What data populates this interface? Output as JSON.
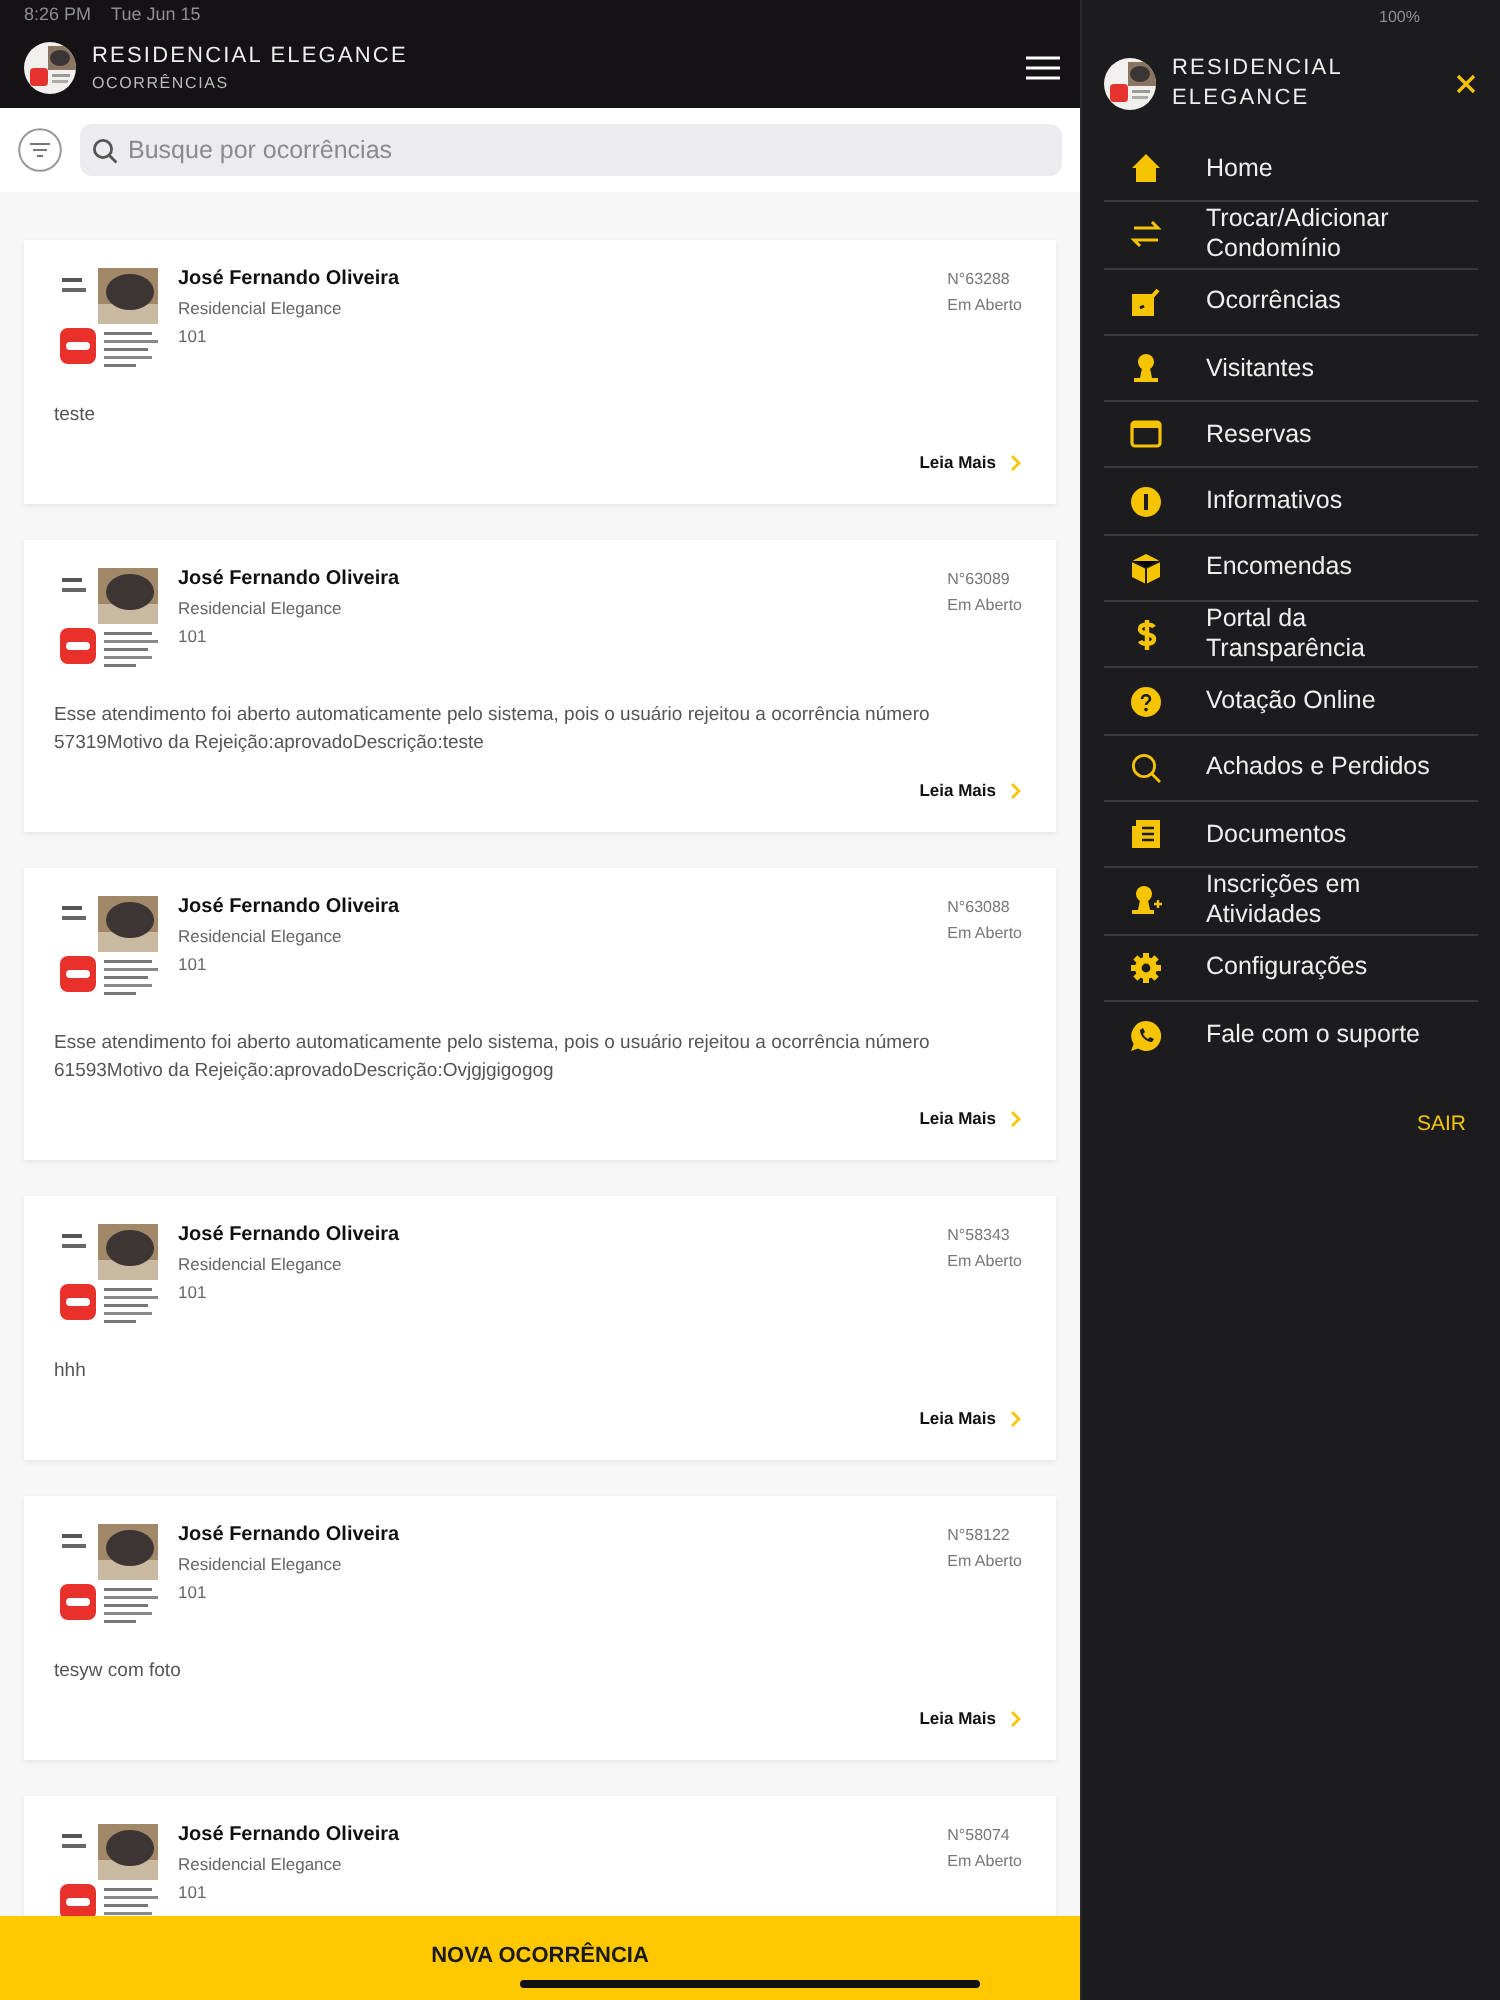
{
  "status_bar": {
    "time": "8:26 PM",
    "date": "Tue Jun 15",
    "battery": "100%"
  },
  "header": {
    "title": "RESIDENCIAL ELEGANCE",
    "subtitle": "OCORRÊNCIAS"
  },
  "search": {
    "placeholder": "Busque por ocorrências"
  },
  "occurrences": [
    {
      "name": "José Fernando Oliveira",
      "condominium": "Residencial Elegance",
      "unit": "101",
      "number": "N°63288",
      "status": "Em Aberto",
      "description": "teste",
      "link": "Leia Mais"
    },
    {
      "name": "José Fernando Oliveira",
      "condominium": "Residencial Elegance",
      "unit": "101",
      "number": "N°63089",
      "status": "Em Aberto",
      "description": "Esse atendimento foi aberto automaticamente pelo sistema, pois o usuário rejeitou a ocorrência número 57319Motivo da Rejeição:aprovadoDescrição:teste",
      "link": "Leia Mais"
    },
    {
      "name": "José Fernando Oliveira",
      "condominium": "Residencial Elegance",
      "unit": "101",
      "number": "N°63088",
      "status": "Em Aberto",
      "description": "Esse atendimento foi aberto automaticamente pelo sistema, pois o usuário rejeitou a ocorrência número 61593Motivo da Rejeição:aprovadoDescrição:Ovjgjgigogog",
      "link": "Leia Mais"
    },
    {
      "name": "José Fernando Oliveira",
      "condominium": "Residencial Elegance",
      "unit": "101",
      "number": "N°58343",
      "status": "Em Aberto",
      "description": "hhh",
      "link": "Leia Mais"
    },
    {
      "name": "José Fernando Oliveira",
      "condominium": "Residencial Elegance",
      "unit": "101",
      "number": "N°58122",
      "status": "Em Aberto",
      "description": "tesyw com foto",
      "link": "Leia Mais"
    },
    {
      "name": "José Fernando Oliveira",
      "condominium": "Residencial Elegance",
      "unit": "101",
      "number": "N°58074",
      "status": "Em Aberto"
    }
  ],
  "drawer": {
    "title": "RESIDENCIAL ELEGANCE",
    "items": [
      {
        "label": "Home"
      },
      {
        "label": "Trocar/Adicionar Condomínio"
      },
      {
        "label": "Ocorrências"
      },
      {
        "label": "Visitantes"
      },
      {
        "label": "Reservas"
      },
      {
        "label": "Informativos"
      },
      {
        "label": "Encomendas"
      },
      {
        "label": "Portal da Transparência"
      },
      {
        "label": "Votação Online"
      },
      {
        "label": "Achados e Perdidos"
      },
      {
        "label": "Documentos"
      },
      {
        "label": "Inscrições em Atividades"
      },
      {
        "label": "Configurações"
      },
      {
        "label": "Fale com o suporte"
      }
    ],
    "logout": "SAIR"
  },
  "new_button": "NOVA OCORRÊNCIA"
}
